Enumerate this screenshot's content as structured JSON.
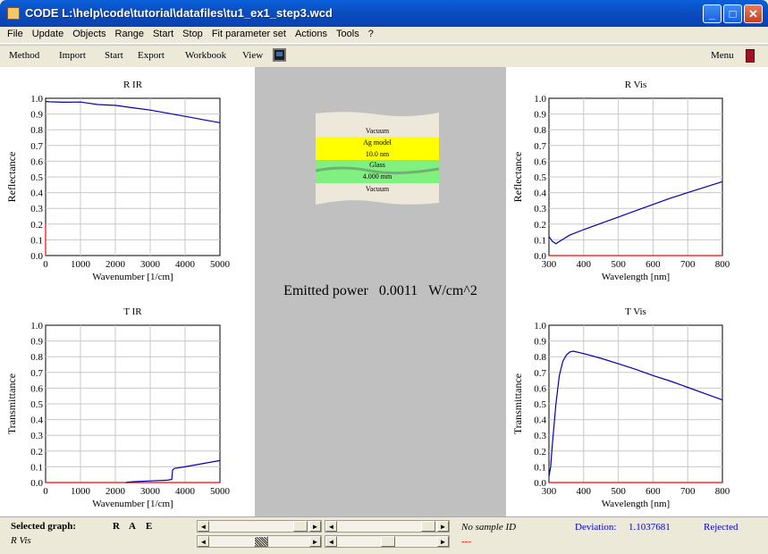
{
  "window": {
    "title": "CODE L:\\help\\code\\tutorial\\datafiles\\tu1_ex1_step3.wcd",
    "minimize_glyph": "_",
    "maximize_glyph": "□",
    "close_glyph": "✕"
  },
  "menubar": [
    "File",
    "Update",
    "Objects",
    "Range",
    "Start",
    "Stop",
    "Fit parameter set",
    "Actions",
    "Tools",
    "?"
  ],
  "toolbar": {
    "items": [
      "Method",
      "Import",
      "Start",
      "Export",
      "Workbook",
      "View"
    ],
    "menu_label": "Menu",
    "icons": [
      "monitor-icon",
      "menu-flag-icon"
    ]
  },
  "layer_stack": {
    "layers": [
      {
        "name": "Vacuum",
        "color": "#ede8da"
      },
      {
        "name": "Ag model",
        "thickness": "10.0 nm",
        "color": "#ffff00"
      },
      {
        "name": "Glass",
        "thickness": "4.000 mm",
        "color": "#80f080"
      },
      {
        "name": "Vacuum",
        "color": "#ede8da"
      }
    ]
  },
  "emitted_power": {
    "label": "Emitted power",
    "value": "0.0011",
    "unit": "W/cm^2"
  },
  "chart_data": [
    {
      "title": "R IR",
      "type": "line",
      "xlabel": "Wavenumber [1/cm]",
      "ylabel": "Reflectance",
      "xlim": [
        0,
        5000
      ],
      "ylim": [
        0,
        1
      ],
      "xticks": [
        "0",
        "1000",
        "2000",
        "3000",
        "4000",
        "5000"
      ],
      "yticks": [
        "0.0",
        "0.1",
        "0.2",
        "0.3",
        "0.4",
        "0.5",
        "0.6",
        "0.7",
        "0.8",
        "0.9",
        "1.0"
      ],
      "grid": true,
      "series": [
        {
          "color": "#0000b0",
          "x": [
            0,
            100,
            500,
            1000,
            1200,
            1500,
            2000,
            2500,
            3000,
            3500,
            4000,
            4500,
            5000
          ],
          "y": [
            0.98,
            0.978,
            0.975,
            0.976,
            0.97,
            0.96,
            0.955,
            0.94,
            0.925,
            0.905,
            0.885,
            0.865,
            0.845
          ]
        },
        {
          "color": "#ff0000",
          "x": [
            0,
            0
          ],
          "y": [
            0.0,
            0.2
          ]
        }
      ]
    },
    {
      "title": "T IR",
      "type": "line",
      "xlabel": "Wavenumber [1/cm]",
      "ylabel": "Transmittance",
      "xlim": [
        0,
        5000
      ],
      "ylim": [
        0,
        1
      ],
      "xticks": [
        "0",
        "1000",
        "2000",
        "3000",
        "4000",
        "5000"
      ],
      "yticks": [
        "0.0",
        "0.1",
        "0.2",
        "0.3",
        "0.4",
        "0.5",
        "0.6",
        "0.7",
        "0.8",
        "0.9",
        "1.0"
      ],
      "grid": true,
      "series": [
        {
          "color": "#ff0000",
          "x": [
            0,
            5000
          ],
          "y": [
            0,
            0
          ]
        },
        {
          "color": "#0000b0",
          "x": [
            2300,
            2500,
            3000,
            3500,
            3620,
            3640,
            3700,
            4000,
            4500,
            5000
          ],
          "y": [
            0.0,
            0.005,
            0.01,
            0.015,
            0.02,
            0.08,
            0.09,
            0.1,
            0.12,
            0.14
          ]
        }
      ]
    },
    {
      "title": "R Vis",
      "type": "line",
      "xlabel": "Wavelength [nm]",
      "ylabel": "Reflectance",
      "xlim": [
        300,
        800
      ],
      "ylim": [
        0,
        1
      ],
      "xticks": [
        "300",
        "400",
        "500",
        "600",
        "700",
        "800"
      ],
      "yticks": [
        "0.0",
        "0.1",
        "0.2",
        "0.3",
        "0.4",
        "0.5",
        "0.6",
        "0.7",
        "0.8",
        "0.9",
        "1.0"
      ],
      "grid": true,
      "series": [
        {
          "color": "#ff0000",
          "x": [
            300,
            800
          ],
          "y": [
            0,
            0
          ]
        },
        {
          "color": "#0000b0",
          "x": [
            300,
            310,
            320,
            330,
            345,
            360,
            400,
            450,
            500,
            550,
            600,
            650,
            700,
            750,
            800
          ],
          "y": [
            0.12,
            0.09,
            0.075,
            0.09,
            0.11,
            0.13,
            0.165,
            0.205,
            0.245,
            0.285,
            0.325,
            0.365,
            0.4,
            0.435,
            0.47
          ]
        }
      ]
    },
    {
      "title": "T Vis",
      "type": "line",
      "xlabel": "Wavelength [nm]",
      "ylabel": "Transmittance",
      "xlim": [
        300,
        800
      ],
      "ylim": [
        0,
        1
      ],
      "xticks": [
        "300",
        "400",
        "500",
        "600",
        "700",
        "800"
      ],
      "yticks": [
        "0.0",
        "0.1",
        "0.2",
        "0.3",
        "0.4",
        "0.5",
        "0.6",
        "0.7",
        "0.8",
        "0.9",
        "1.0"
      ],
      "grid": true,
      "series": [
        {
          "color": "#ff0000",
          "x": [
            300,
            800
          ],
          "y": [
            0,
            0
          ]
        },
        {
          "color": "#0000b0",
          "x": [
            300,
            305,
            310,
            320,
            330,
            340,
            350,
            360,
            370,
            400,
            450,
            500,
            550,
            600,
            650,
            700,
            750,
            800
          ],
          "y": [
            0.04,
            0.1,
            0.25,
            0.5,
            0.68,
            0.77,
            0.81,
            0.83,
            0.835,
            0.82,
            0.79,
            0.755,
            0.72,
            0.68,
            0.645,
            0.605,
            0.565,
            0.525
          ]
        }
      ]
    }
  ],
  "status": {
    "selected_graph_label": "Selected graph:",
    "rae": [
      "R",
      "A",
      "E"
    ],
    "selected_graph_value": "R Vis",
    "sample_id": "No sample ID",
    "sample_sub": "---",
    "deviation_label": "Deviation:",
    "deviation_value": "1.1037681",
    "result": "Rejected",
    "arrow_left": "◄",
    "arrow_right": "►"
  }
}
